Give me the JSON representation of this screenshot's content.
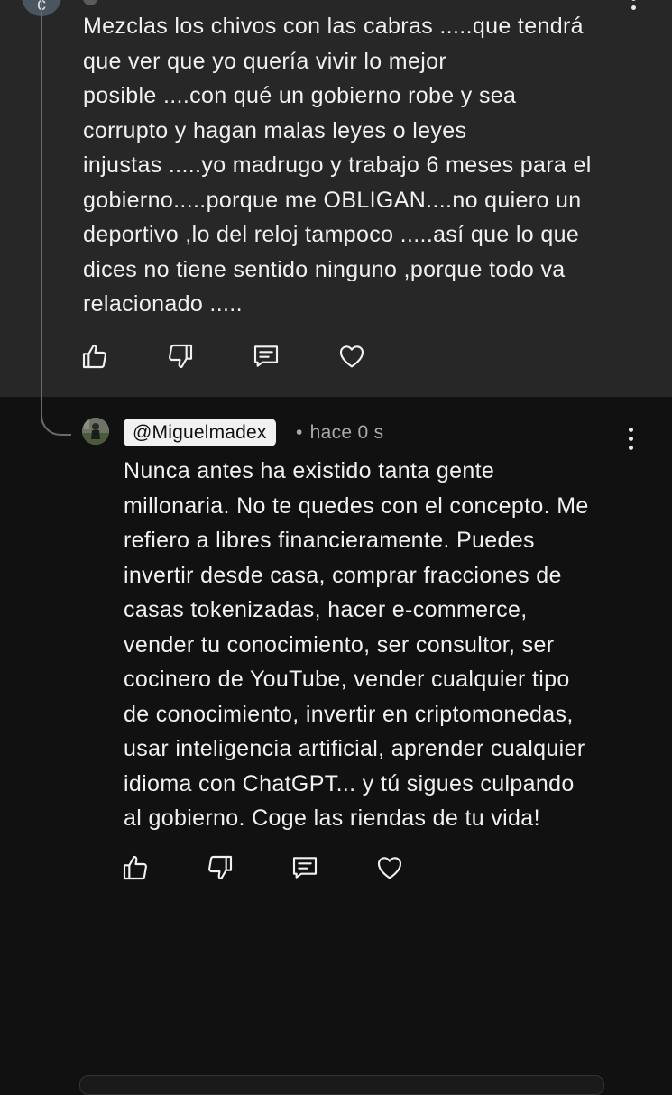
{
  "top_comment": {
    "avatar_letter": "c",
    "text": "Mezclas los chivos con las cabras .....que tendrá\nque ver que yo quería vivir lo mejor\nposible ....con qué un gobierno robe y sea\ncorrupto y hagan malas leyes o leyes\ninjustas .....yo madrugo y trabajo 6 meses para el\ngobierno.....porque me OBLIGAN....no quiero un\ndeportivo ,lo del reloj  tampoco .....así que lo que\ndices no tiene sentido ninguno ,porque todo va\nrelacionado .....",
    "actions": [
      "like-icon",
      "dislike-icon",
      "reply-icon",
      "heart-icon"
    ]
  },
  "reply": {
    "handle": "@Miguelmadex",
    "separator": "•",
    "timestamp": "hace 0 s",
    "text": "Nunca antes ha existido tanta gente\nmillonaria. No te quedes con el concepto. Me\nrefiero a libres financieramente. Puedes\ninvertir desde casa, comprar fracciones de\ncasas tokenizadas, hacer e-commerce,\nvender tu conocimiento, ser consultor, ser\ncocinero de YouTube, vender cualquier tipo\nde conocimiento, invertir en criptomonedas,\nusar inteligencia artificial, aprender cualquier\nidioma con ChatGPT... y tú sigues culpando\nal gobierno. Coge las riendas de tu vida!",
    "actions": [
      "like-icon",
      "dislike-icon",
      "reply-icon",
      "heart-icon"
    ]
  },
  "colors": {
    "top_bg": "#272727",
    "page_bg": "#111111",
    "text": "#f1f1f1",
    "meta": "#aaaaaa",
    "handle_bg": "#f1f1f1"
  }
}
